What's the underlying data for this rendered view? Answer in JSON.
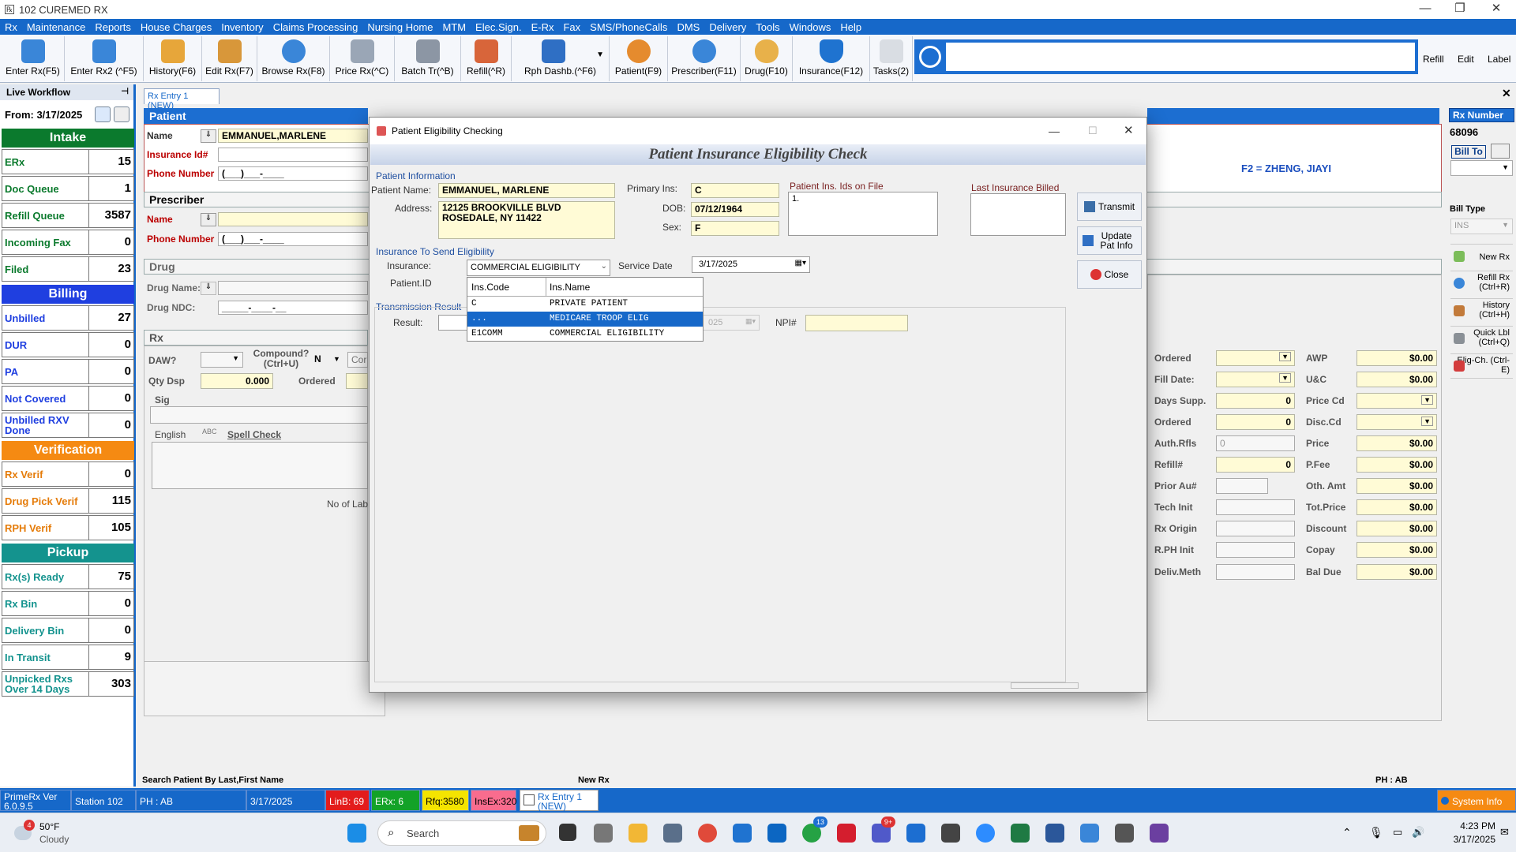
{
  "window": {
    "title": "102 CUREMED RX"
  },
  "menu": [
    "Rx",
    "Maintenance",
    "Reports",
    "House Charges",
    "Inventory",
    "Claims Processing",
    "Nursing Home",
    "MTM",
    "Elec.Sign.",
    "E-Rx",
    "Fax",
    "SMS/PhoneCalls",
    "DMS",
    "Delivery",
    "Tools",
    "Windows",
    "Help"
  ],
  "toolbar": {
    "buttons": [
      "Enter Rx(F5)",
      "Enter Rx2 (^F5)",
      "History(F6)",
      "Edit Rx(F7)",
      "Browse Rx(F8)",
      "Price Rx(^C)",
      "Batch Tr(^B)",
      "Refill(^R)",
      "Rph Dashb.(^F6)",
      "Patient(F9)",
      "Prescriber(F11)",
      "Drug(F10)",
      "Insurance(F12)",
      "Tasks(2)"
    ],
    "right": [
      "Refill",
      "Edit",
      "Label"
    ]
  },
  "live_workflow": {
    "title": "Live Workflow",
    "from_label": "From: 3/17/2025",
    "sections": {
      "intake": "Intake",
      "billing": "Billing",
      "verification": "Verification",
      "pickup": "Pickup"
    },
    "intake_items": [
      {
        "label": "ERx",
        "count": "15"
      },
      {
        "label": "Doc Queue",
        "count": "1"
      },
      {
        "label": "Refill Queue",
        "count": "3587"
      },
      {
        "label": "Incoming Fax",
        "count": "0"
      },
      {
        "label": "Filed",
        "count": "23"
      }
    ],
    "billing_items": [
      {
        "label": "Unbilled",
        "count": "27"
      },
      {
        "label": "DUR",
        "count": "0"
      },
      {
        "label": "PA",
        "count": "0"
      },
      {
        "label": "Not Covered",
        "count": "0"
      },
      {
        "label": "Unbilled RXV Done",
        "count": "0"
      }
    ],
    "verification_items": [
      {
        "label": "Rx Verif",
        "count": "0"
      },
      {
        "label": "Drug Pick Verif",
        "count": "115"
      },
      {
        "label": "RPH Verif",
        "count": "105"
      }
    ],
    "pickup_items": [
      {
        "label": "Rx(s) Ready",
        "count": "75"
      },
      {
        "label": "Rx Bin",
        "count": "0"
      },
      {
        "label": "Delivery Bin",
        "count": "0"
      },
      {
        "label": "In Transit",
        "count": "9"
      },
      {
        "label": "Unpicked Rxs Over 14 Days",
        "count": "303"
      }
    ]
  },
  "rx_entry": {
    "tab": "Rx Entry 1 (NEW)",
    "patient_header": "Patient",
    "name_label": "Name",
    "name_value": "EMMANUEL,MARLENE",
    "insurance_id_label": "Insurance Id#",
    "phone_label": "Phone Number",
    "phone_mask": "(___)___-____",
    "prescriber_header": "Prescriber",
    "pres_name_label": "Name",
    "pres_phone_label": "Phone Number",
    "pres_phone_mask": "(___)___-____",
    "drug_header": "Drug",
    "drug_name_label": "Drug Name:",
    "drug_ndc_label": "Drug NDC:",
    "drug_ndc_mask": "_____-____-__",
    "rx_header": "Rx",
    "daw_label": "DAW?",
    "compound_label": "Compound? (Ctrl+U)",
    "compound_value": "N",
    "compound_right": "Cor",
    "qty_label": "Qty Dsp",
    "qty_value": "0.000",
    "ordered_label": "Ordered",
    "sig_label": "Sig",
    "english_label": "English",
    "spell_check": "Spell Check",
    "no_lab": "No of Lab",
    "prescriber_f2": "F2 = ZHENG, JIAYI"
  },
  "pricing": {
    "left": [
      {
        "label": "Ordered",
        "value": ""
      },
      {
        "label": "Fill Date:",
        "value": ""
      },
      {
        "label": "Days Supp.",
        "value": "0"
      },
      {
        "label": "Ordered",
        "value": "0"
      },
      {
        "label": "Auth.Rfls",
        "value": "0"
      },
      {
        "label": "Refill#",
        "value": "0"
      },
      {
        "label": "Prior Au#",
        "value": ""
      },
      {
        "label": "Tech Init",
        "value": ""
      },
      {
        "label": "Rx Origin",
        "value": ""
      },
      {
        "label": "R.PH Init",
        "value": ""
      },
      {
        "label": "Deliv.Meth",
        "value": ""
      }
    ],
    "right": [
      {
        "label": "AWP",
        "value": "$0.00"
      },
      {
        "label": "U&C",
        "value": "$0.00"
      },
      {
        "label": "Price Cd",
        "value": ""
      },
      {
        "label": "Disc.Cd",
        "value": ""
      },
      {
        "label": "Price",
        "value": "$0.00"
      },
      {
        "label": "P.Fee",
        "value": "$0.00"
      },
      {
        "label": "Oth. Amt",
        "value": "$0.00"
      },
      {
        "label": "Tot.Price",
        "value": "$0.00"
      },
      {
        "label": "Discount",
        "value": "$0.00"
      },
      {
        "label": "Copay",
        "value": "$0.00"
      },
      {
        "label": "Bal Due",
        "value": "$0.00"
      }
    ]
  },
  "right_panel": {
    "rx_number_label": "Rx Number",
    "rx_number": "68096",
    "bill_to": "Bill To",
    "bill_type_label": "Bill Type",
    "bill_type_value": "INS",
    "buttons": [
      "New Rx",
      "Refill Rx (Ctrl+R)",
      "History (Ctrl+H)",
      "Quick Lbl (Ctrl+Q)",
      "Elig-Ch. (Ctrl-E)"
    ]
  },
  "dialog": {
    "title": "Patient Eligibility Checking",
    "header": "Patient Insurance Eligibility Check",
    "patient_info_label": "Patient Information",
    "patient_name_label": "Patient Name:",
    "patient_name": "EMMANUEL, MARLENE",
    "address_label": "Address:",
    "address_line1": "12125 BROOKVILLE BLVD",
    "address_line2": "ROSEDALE, NY 11422",
    "primary_ins_label": "Primary Ins:",
    "primary_ins": "C",
    "dob_label": "DOB:",
    "dob": "07/12/1964",
    "sex_label": "Sex:",
    "sex": "F",
    "ins_ids_label": "Patient Ins. Ids on File",
    "ins_ids_value": "1.",
    "last_billed_label": "Last Insurance Billed",
    "insurance_to_send_label": "Insurance To Send Eligibility",
    "insurance_label": "Insurance:",
    "insurance_value": "COMMERCIAL ELIGIBILITY",
    "service_date_label": "Service Date",
    "service_date": "3/17/2025",
    "patient_id_label": "Patient.ID",
    "transmission_result_label": "Transmission Result",
    "result_label": "Result:",
    "hidden_date_fragment": "025",
    "npi_label": "NPI#",
    "buttons": {
      "transmit": "Transmit",
      "update": "Update Pat Info",
      "close": "Close"
    },
    "dropdown": {
      "headers": [
        "Ins.Code",
        "Ins.Name"
      ],
      "rows": [
        {
          "code": "C",
          "name": "PRIVATE PATIENT",
          "selected": false
        },
        {
          "code": "...",
          "name": "MEDICARE TROOP ELIG",
          "selected": true
        },
        {
          "code": "E1COMM",
          "name": "COMMERCIAL ELIGIBILITY",
          "selected": false
        }
      ]
    }
  },
  "status": {
    "search_hint": "Search Patient By Last,First Name",
    "new_rx": "New Rx",
    "ph": "PH : AB",
    "version": "PrimeRx Ver 6.0.9.5",
    "station": "Station 102",
    "ph2": "PH : AB",
    "date": "3/17/2025",
    "linb": "LinB: 69",
    "erx": "ERx: 6",
    "rfq": "Rfq:3580",
    "insex": "InsEx:320",
    "open_tab": "Rx Entry 1 (NEW)",
    "system_info": "System Info"
  },
  "taskbar": {
    "weather_temp": "50°F",
    "weather_desc": "Cloudy",
    "weather_badge": "4",
    "search": "Search",
    "time": "4:23 PM",
    "date": "3/17/2025",
    "badges": {
      "whatsapp": "13",
      "teams": "9+"
    }
  },
  "colors": {
    "accent": "#1668c9",
    "intake": "#0b7a2d",
    "billing": "#1f3fe0",
    "verification": "#f58a12",
    "pickup": "#14938e",
    "selected": "#1668c9"
  }
}
